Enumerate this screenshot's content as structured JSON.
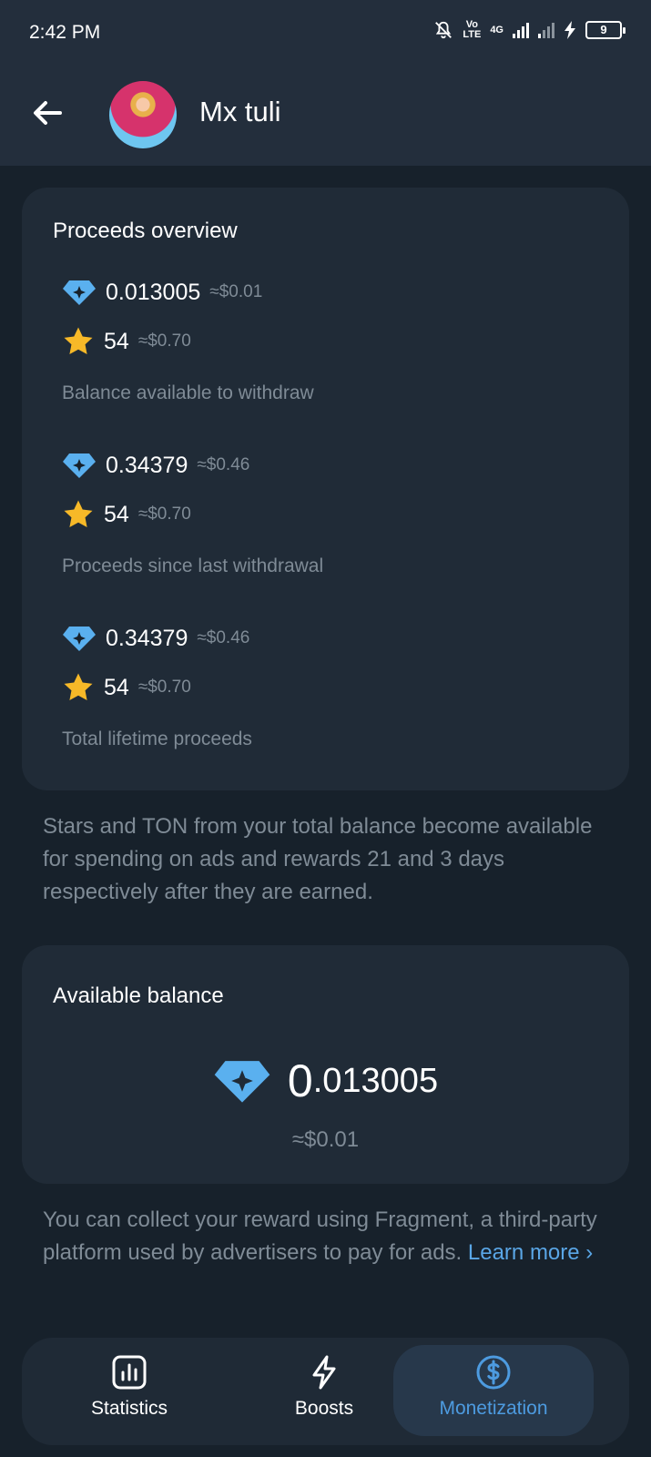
{
  "status_bar": {
    "time": "2:42 PM",
    "volte_top": "Vo",
    "volte_bottom": "LTE",
    "network": "4G",
    "battery": "9"
  },
  "header": {
    "back_icon": "arrow-left-icon",
    "title": "Mx tuli"
  },
  "overview": {
    "title": "Proceeds overview",
    "sections": [
      {
        "ton_value": "0.013005",
        "ton_usd": "≈$0.01",
        "stars_value": "54",
        "stars_usd": "≈$0.70",
        "caption": "Balance available to withdraw"
      },
      {
        "ton_value": "0.34379",
        "ton_usd": "≈$0.46",
        "stars_value": "54",
        "stars_usd": "≈$0.70",
        "caption": "Proceeds since last withdrawal"
      },
      {
        "ton_value": "0.34379",
        "ton_usd": "≈$0.46",
        "stars_value": "54",
        "stars_usd": "≈$0.70",
        "caption": "Total lifetime proceeds"
      }
    ]
  },
  "info_note": "Stars and TON from your total balance become available for spending on ads and rewards 21 and 3 days respectively after they are earned.",
  "available": {
    "title": "Available balance",
    "int_part": "0",
    "frac_part": ".013005",
    "usd": "≈$0.01"
  },
  "fragment_note": {
    "text": "You can collect your reward using Fragment, a third-party platform used by advertisers to pay for ads. ",
    "link": "Learn more ›"
  },
  "tabs": [
    {
      "label": "Statistics",
      "icon": "bar-chart-icon",
      "active": false
    },
    {
      "label": "Boosts",
      "icon": "lightning-icon",
      "active": false
    },
    {
      "label": "Monetization",
      "icon": "dollar-coin-icon",
      "active": true
    }
  ],
  "colors": {
    "background": "#17212b",
    "card": "#202b37",
    "header": "#232e3c",
    "secondary_text": "#7f8b96",
    "accent": "#4d9be0",
    "ton_diamond": "#5ab0ef",
    "star": "#f7b928"
  }
}
